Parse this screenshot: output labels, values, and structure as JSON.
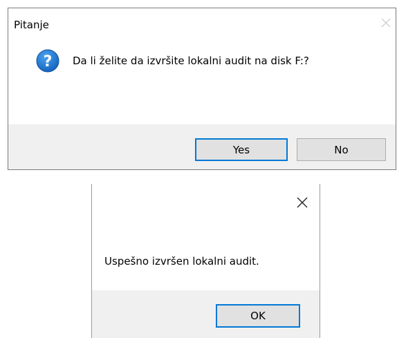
{
  "dialog_question": {
    "title": "Pitanje",
    "close_icon": "close-icon",
    "icon": "question-icon",
    "message": "Da li želite da izvršite lokalni audit na disk F:?",
    "yes_label": "Yes",
    "no_label": "No",
    "accent_color": "#0078d7"
  },
  "dialog_result": {
    "close_icon": "close-icon",
    "message": "Uspešno izvršen lokalni audit.",
    "ok_label": "OK"
  }
}
